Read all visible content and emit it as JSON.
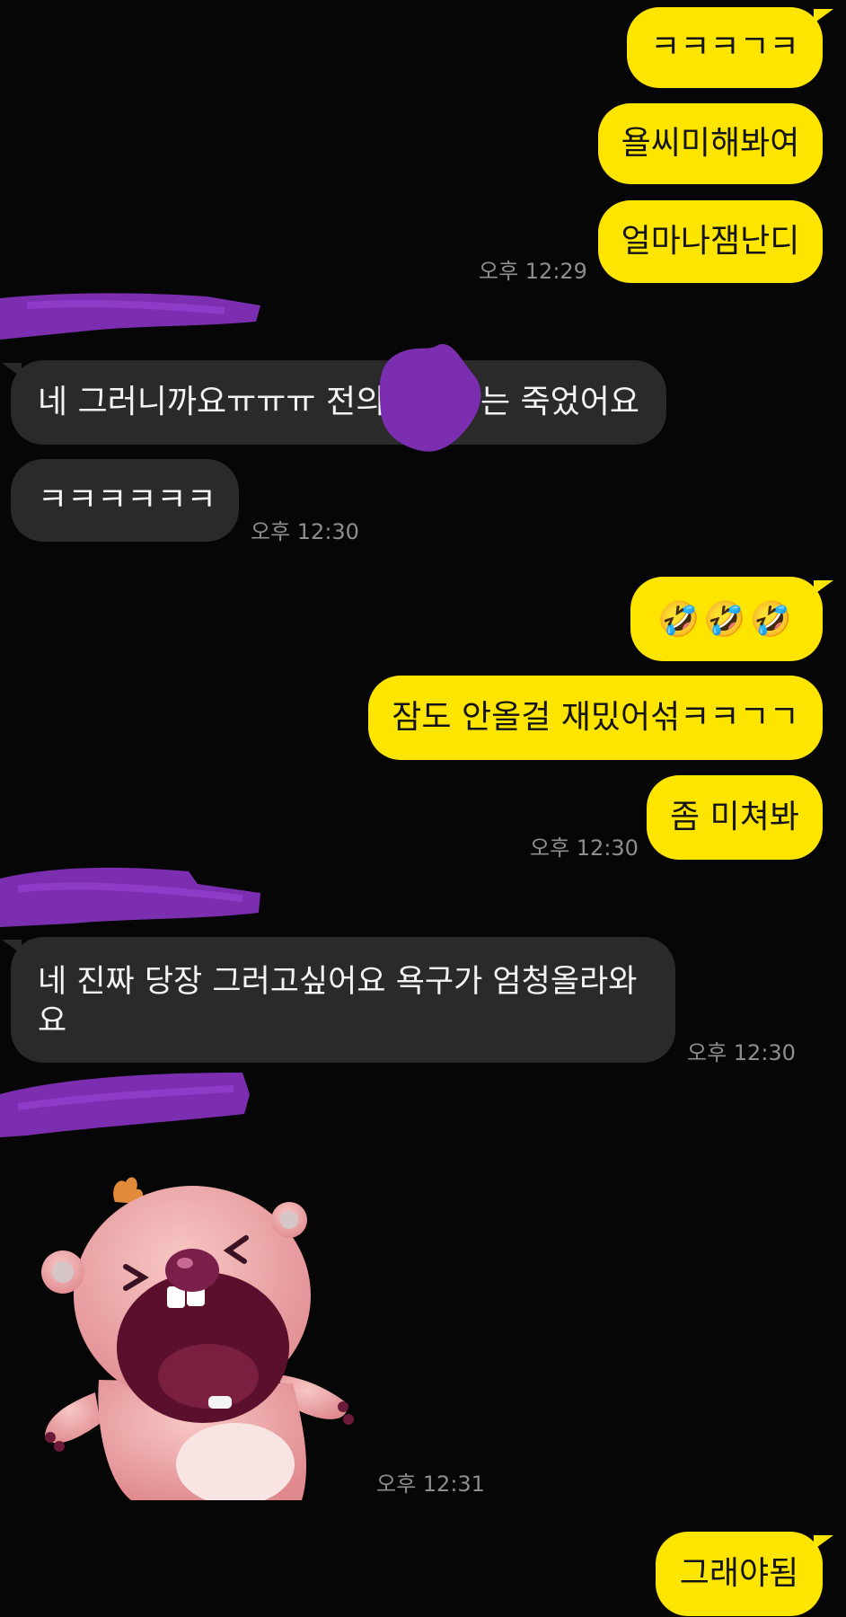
{
  "messages": {
    "m1": "ㅋㅋㅋㄱㅋ",
    "m2": "욜씨미해봐여",
    "m3": "얼마나잼난디",
    "t1": "오후 12:29",
    "o1_before": "네 그러니까요ㅠㅠㅠ 전의 ",
    "o1_after": "는 죽었어요",
    "o2": "ㅋㅋㅋㅋㅋㅋ",
    "t2": "오후 12:30",
    "m4": "🤣🤣🤣",
    "m5": "잠도 안올걸 재밌어섞ㅋㅋㄱㄱ",
    "m6": "좀 미쳐봐",
    "t3": "오후 12:30",
    "o3": "네 진짜 당장 그러고싶어요 욕구가 엄청올라와요",
    "t4": "오후 12:30",
    "t5": "오후 12:31",
    "m7": "그래야됨"
  },
  "colors": {
    "background": "#060606",
    "my_bubble": "#FEE500",
    "other_bubble": "#2A2A2A",
    "redaction": "#7B2FB0"
  },
  "sticker": {
    "name": "pink-beaver-laughing-sticker"
  }
}
